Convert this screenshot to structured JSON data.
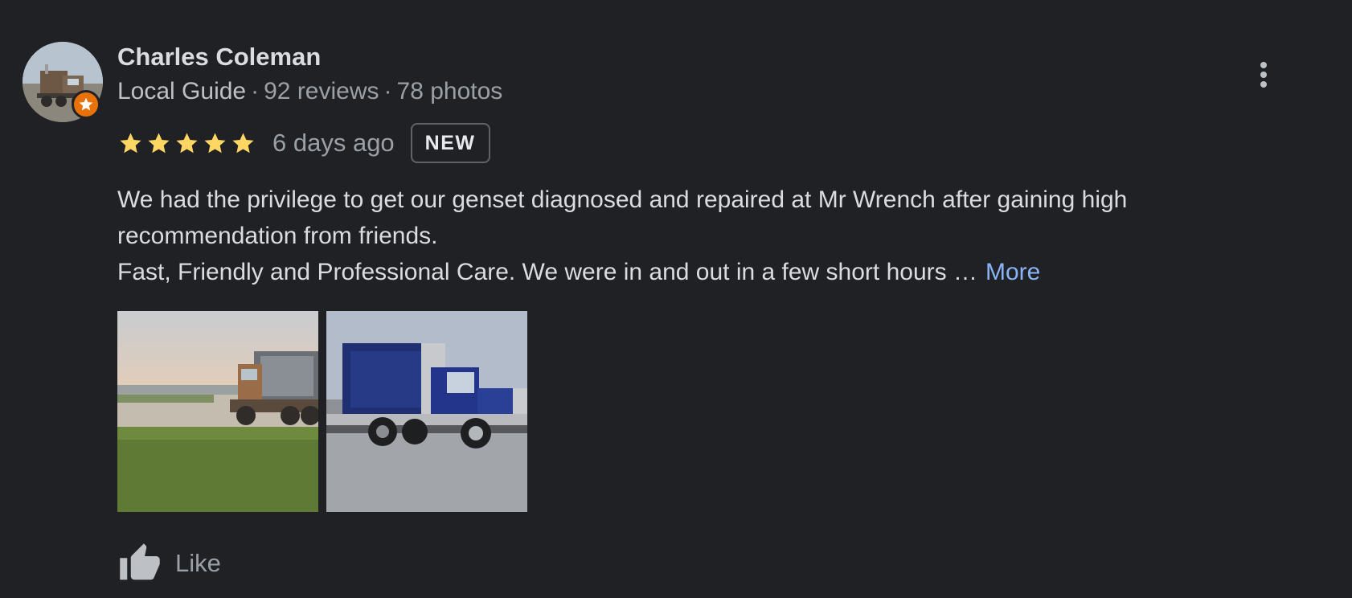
{
  "review": {
    "author": {
      "name": "Charles Coleman",
      "badge": "Local Guide",
      "separator": "·",
      "reviews": "92 reviews",
      "photos": "78 photos"
    },
    "rating": {
      "stars": 5,
      "max_stars": 5,
      "star_color": "#fdd663"
    },
    "date": "6 days ago",
    "new_label": "NEW",
    "text": {
      "line1": "We had the privilege to get our genset diagnosed and repaired at Mr Wrench after gaining high",
      "line2": "recommendation from friends.",
      "line3": "Fast, Friendly and Professional Care. We were in and out in a few short hours …",
      "more_label": "More"
    },
    "photos": [
      {
        "icon": "truck-lot-photo"
      },
      {
        "icon": "blue-semi-truck-photo"
      }
    ],
    "actions": {
      "like_label": "Like",
      "like_icon": "thumbs-up-icon",
      "menu_icon": "more-vert-icon"
    }
  },
  "colors": {
    "background": "#202124",
    "link": "#8ab4f8",
    "guide_badge": "#e8710a",
    "muted_text": "#9aa0a6",
    "primary_text": "#dadce0"
  }
}
